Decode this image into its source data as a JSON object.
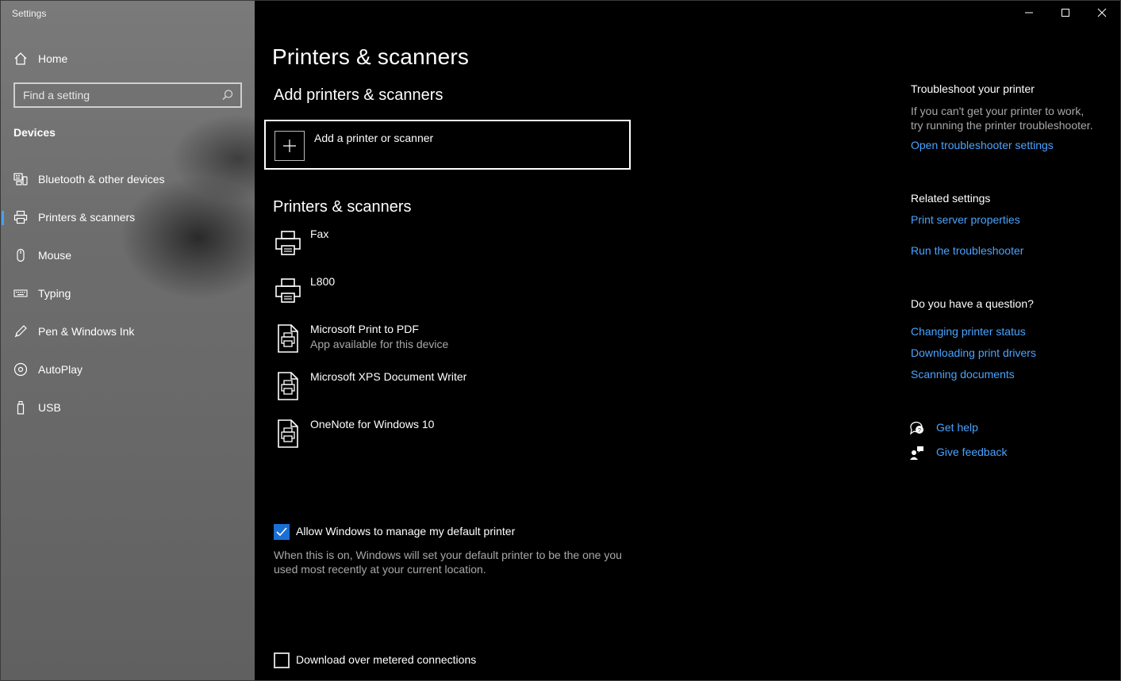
{
  "window": {
    "title": "Settings"
  },
  "sidebar": {
    "home_label": "Home",
    "search_placeholder": "Find a setting",
    "section": "Devices",
    "items": [
      {
        "label": "Bluetooth & other devices",
        "icon": "bluetooth-devices-icon"
      },
      {
        "label": "Printers & scanners",
        "icon": "printer-icon",
        "active": true
      },
      {
        "label": "Mouse",
        "icon": "mouse-icon"
      },
      {
        "label": "Typing",
        "icon": "keyboard-icon"
      },
      {
        "label": "Pen & Windows Ink",
        "icon": "pen-icon"
      },
      {
        "label": "AutoPlay",
        "icon": "autoplay-icon"
      },
      {
        "label": "USB",
        "icon": "usb-icon"
      }
    ]
  },
  "main": {
    "title": "Printers & scanners",
    "add_heading": "Add printers & scanners",
    "add_button": "Add a printer or scanner",
    "list_heading": "Printers & scanners",
    "printers": [
      {
        "name": "Fax",
        "sub": ""
      },
      {
        "name": "L800",
        "sub": ""
      },
      {
        "name": "Microsoft Print to PDF",
        "sub": "App available for this device"
      },
      {
        "name": "Microsoft XPS Document Writer",
        "sub": ""
      },
      {
        "name": "OneNote for Windows 10",
        "sub": ""
      }
    ],
    "default_printer": {
      "label": "Allow Windows to manage my default printer",
      "checked": true,
      "desc_line1": "When this is on, Windows will set your default printer to be the one you",
      "desc_line2": "used most recently at your current location."
    },
    "metered": {
      "label": "Download over metered connections",
      "checked": false
    }
  },
  "right": {
    "troubleshoot_heading": "Troubleshoot your printer",
    "troubleshoot_text1": "If you can't get your printer to work,",
    "troubleshoot_text2": "try running the printer troubleshooter.",
    "troubleshoot_link": "Open troubleshooter settings",
    "related_heading": "Related settings",
    "related_links": [
      "Print server properties",
      "Run the troubleshooter"
    ],
    "question_heading": "Do you have a question?",
    "question_links": [
      "Changing printer status",
      "Downloading print drivers",
      "Scanning documents"
    ],
    "get_help": "Get help",
    "give_feedback": "Give feedback"
  },
  "colors": {
    "accent": "#4aa3ff",
    "checkbox": "#1a6fd4",
    "background": "#000000"
  }
}
